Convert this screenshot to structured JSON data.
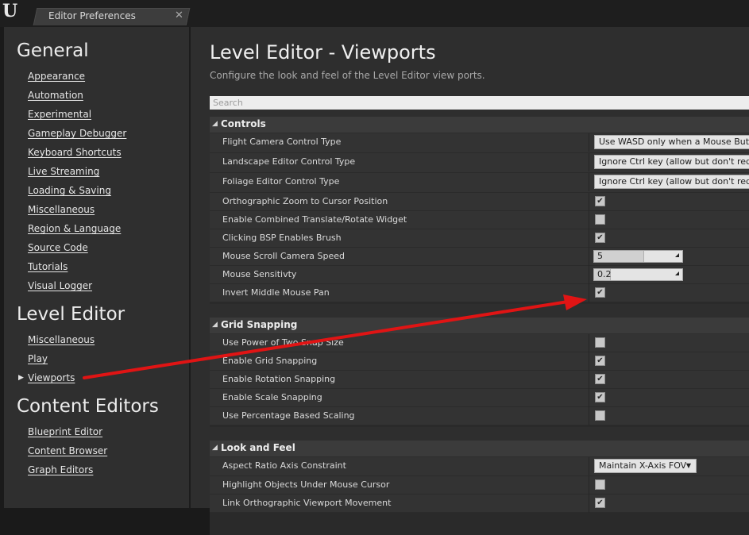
{
  "window": {
    "title": "Editor Preferences",
    "close": "✕",
    "logo": "U",
    "logo_icon": "unreal-logo-icon"
  },
  "sidebar": {
    "sections": [
      {
        "heading": "General",
        "items": [
          "Appearance",
          "Automation",
          "Experimental",
          "Gameplay Debugger",
          "Keyboard Shortcuts",
          "Live Streaming",
          "Loading & Saving",
          "Miscellaneous",
          "Region & Language",
          "Source Code",
          "Tutorials",
          "Visual Logger"
        ]
      },
      {
        "heading": "Level Editor",
        "items": [
          "Miscellaneous",
          "Play",
          "Viewports"
        ]
      },
      {
        "heading": "Content Editors",
        "items": [
          "Blueprint Editor",
          "Content Browser",
          "Graph Editors"
        ]
      }
    ],
    "selected": "Viewports",
    "selected_marker": "▶"
  },
  "main": {
    "title": "Level Editor - Viewports",
    "description": "Configure the look and feel of the Level Editor view ports.",
    "search_placeholder": "Search",
    "categories": [
      {
        "label": "Controls",
        "rows": [
          {
            "label": "Flight Camera Control Type",
            "type": "combo",
            "value": "Use WASD only when a Mouse Button is Pressed"
          },
          {
            "label": "Landscape Editor Control Type",
            "type": "combo",
            "value": "Ignore Ctrl key (allow but don't require)"
          },
          {
            "label": "Foliage Editor Control Type",
            "type": "combo",
            "value": "Ignore Ctrl key (allow but don't require)"
          },
          {
            "label": "Orthographic Zoom to Cursor Position",
            "type": "check",
            "value": "✔"
          },
          {
            "label": "Enable Combined Translate/Rotate Widget",
            "type": "check",
            "value": ""
          },
          {
            "label": "Clicking BSP Enables Brush",
            "type": "check",
            "value": "✔"
          },
          {
            "label": "Mouse Scroll Camera Speed",
            "type": "spin",
            "value": "5",
            "fill": 0.56
          },
          {
            "label": "Mouse Sensitivty",
            "type": "spin",
            "value": "0.2",
            "fill": 0.18
          },
          {
            "label": "Invert Middle Mouse Pan",
            "type": "check",
            "value": "✔"
          }
        ]
      },
      {
        "label": "Grid Snapping",
        "rows": [
          {
            "label": "Use Power of Two Snap Size",
            "type": "check",
            "value": ""
          },
          {
            "label": "Enable Grid Snapping",
            "type": "check",
            "value": "✔"
          },
          {
            "label": "Enable Rotation Snapping",
            "type": "check",
            "value": "✔"
          },
          {
            "label": "Enable Scale Snapping",
            "type": "check",
            "value": "✔"
          },
          {
            "label": "Use Percentage Based Scaling",
            "type": "check",
            "value": ""
          }
        ]
      },
      {
        "label": "Look and Feel",
        "rows": [
          {
            "label": "Aspect Ratio Axis Constraint",
            "type": "combo-small",
            "value": "Maintain X-Axis FOV"
          },
          {
            "label": "Highlight Objects Under Mouse Cursor",
            "type": "check",
            "value": ""
          },
          {
            "label": "Link Orthographic Viewport Movement",
            "type": "check",
            "value": "✔"
          }
        ]
      }
    ],
    "collapse_marker": "◢",
    "combo_marker": "▼"
  },
  "colors": {
    "annotation_arrow": "#e01414",
    "background": "#2e2e2e",
    "header": "#3b3b3b"
  }
}
